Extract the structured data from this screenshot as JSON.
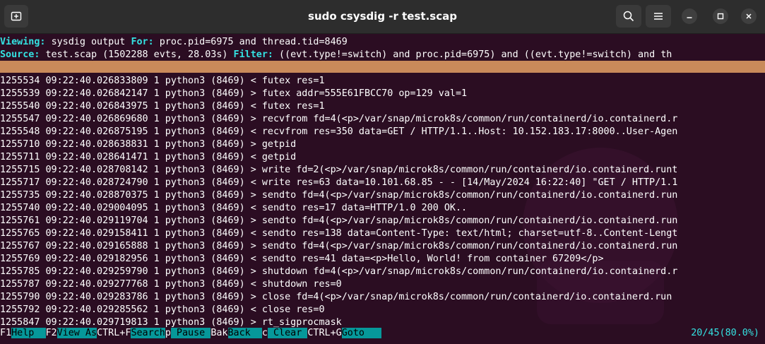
{
  "window": {
    "title": "sudo csysdig -r test.scap"
  },
  "header": {
    "viewing_label": "Viewing:",
    "viewing_value": "sysdig output",
    "for_label": "For:",
    "for_value": "proc.pid=6975 and thread.tid=8469",
    "source_label": "Source:",
    "source_value": "test.scap (1502288 evts, 28.03s)",
    "filter_label": "Filter:",
    "filter_value": "((evt.type!=switch) and proc.pid=6975) and ((evt.type!=switch) and th"
  },
  "events": [
    "1255534 09:22:40.026833809 1 python3 (8469) < futex res=1",
    "1255539 09:22:40.026842147 1 python3 (8469) > futex addr=555E61FBCC70 op=129 val=1",
    "1255540 09:22:40.026843975 1 python3 (8469) < futex res=1",
    "1255547 09:22:40.026869680 1 python3 (8469) > recvfrom fd=4(<p>/var/snap/microk8s/common/run/containerd/io.containerd.r",
    "1255548 09:22:40.026875195 1 python3 (8469) < recvfrom res=350 data=GET / HTTP/1.1..Host: 10.152.183.17:8000..User-Agen",
    "1255710 09:22:40.028638831 1 python3 (8469) > getpid",
    "1255711 09:22:40.028641471 1 python3 (8469) < getpid",
    "1255715 09:22:40.028708142 1 python3 (8469) > write fd=2(<p>/var/snap/microk8s/common/run/containerd/io.containerd.runt",
    "1255717 09:22:40.028724790 1 python3 (8469) < write res=63 data=10.101.68.85 - - [14/May/2024 16:22:40] \"GET / HTTP/1.1",
    "1255735 09:22:40.028870375 1 python3 (8469) > sendto fd=4(<p>/var/snap/microk8s/common/run/containerd/io.containerd.run",
    "1255740 09:22:40.029004095 1 python3 (8469) < sendto res=17 data=HTTP/1.0 200 OK..",
    "1255761 09:22:40.029119704 1 python3 (8469) > sendto fd=4(<p>/var/snap/microk8s/common/run/containerd/io.containerd.run",
    "1255765 09:22:40.029158411 1 python3 (8469) < sendto res=138 data=Content-Type: text/html; charset=utf-8..Content-Lengt",
    "1255767 09:22:40.029165888 1 python3 (8469) > sendto fd=4(<p>/var/snap/microk8s/common/run/containerd/io.containerd.run",
    "1255769 09:22:40.029182956 1 python3 (8469) < sendto res=41 data=<p>Hello, World! from container 67209</p>",
    "1255785 09:22:40.029259790 1 python3 (8469) > shutdown fd=4(<p>/var/snap/microk8s/common/run/containerd/io.containerd.r",
    "1255787 09:22:40.029277768 1 python3 (8469) < shutdown res=0",
    "1255790 09:22:40.029283786 1 python3 (8469) > close fd=4(<p>/var/snap/microk8s/common/run/containerd/io.containerd.run",
    "1255792 09:22:40.029285562 1 python3 (8469) < close res=0",
    "1255847 09:22:40.029719813 1 python3 (8469) > rt_sigprocmask"
  ],
  "fnbar": {
    "f1_key": "F1",
    "f1_label": "Help  ",
    "f2_key": "F2",
    "f2_label": "View As",
    "f3_key": "CTRL+F",
    "f3_label": "Search",
    "f4_key": "p",
    "f4_label": " Pause ",
    "f5_key": "Bak",
    "f5_label": "Back  ",
    "f6_key": "c",
    "f6_label": " Clear ",
    "f7_key": "CTRL+G",
    "f7_label": "Goto   ",
    "progress": "20/45(80.0%)"
  },
  "colors": {
    "background": "#2b0d22",
    "titlebar": "#2d2d2d",
    "keyword": "#34e2e2",
    "divider": "#c98a5a",
    "fn_label_bg": "#06989a"
  }
}
